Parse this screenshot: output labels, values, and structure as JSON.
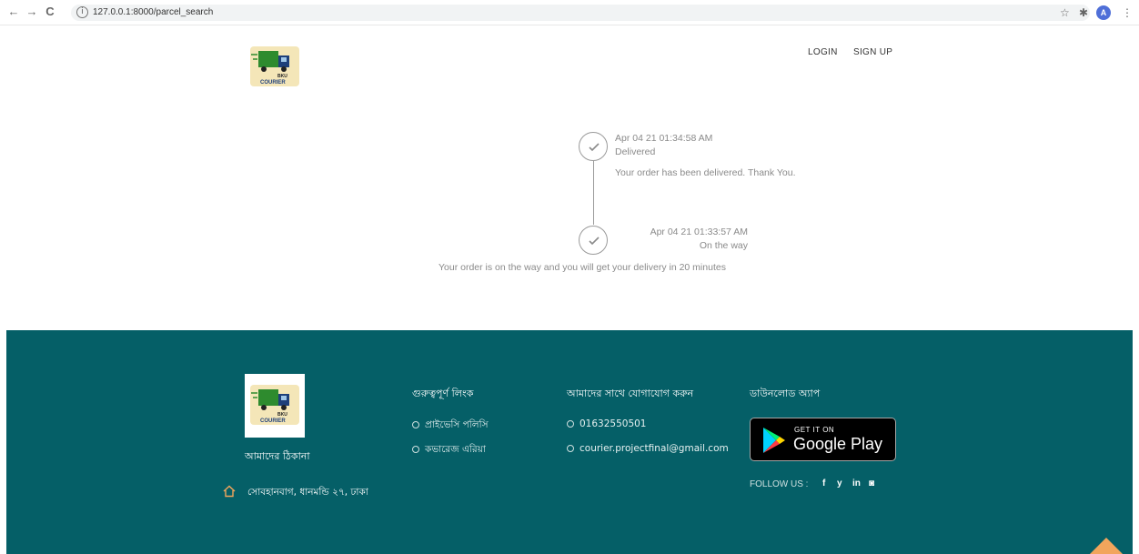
{
  "browser": {
    "back": "←",
    "forward": "→",
    "reload": "C",
    "info": "i",
    "url": "127.0.0.1:8000/parcel_search",
    "star": "☆",
    "extensions": "✱",
    "profile_initial": "A",
    "menu": "⋮"
  },
  "header": {
    "logo_top": "BKU",
    "logo_bottom": "COURIER",
    "nav": [
      "LOGIN",
      "SIGN UP"
    ]
  },
  "timeline": [
    {
      "datetime": "Apr 04 21 01:34:58 AM",
      "status": "Delivered",
      "message": "Your order has been delivered. Thank You."
    },
    {
      "datetime": "Apr 04 21 01:33:57 AM",
      "status": "On the way",
      "message": "Your order is on the way and you will get your delivery in 20 minutes"
    }
  ],
  "footer": {
    "logo_top": "BKU",
    "logo_bottom": "COURIER",
    "address_heading": "আমাদের ঠিকানা",
    "address": "সোবহানবাগ, ধানমন্ডি ২৭, ঢাকা",
    "links_heading": "গুরুত্বপূর্ণ লিংক",
    "links": [
      "প্রাইভেসি পলিসি",
      "কভারেজ এরিয়া"
    ],
    "contact_heading": "আমাদের সাথে যোগাযোগ করুন",
    "contact": [
      "01632550501",
      "courier.projectfinal@gmail.com"
    ],
    "download_heading": "ডাউনলোড অ্যাপ",
    "store_small": "GET IT ON",
    "store_big": "Google Play",
    "follow_label": "FOLLOW US :",
    "social": [
      "f",
      "y",
      "in",
      "◙"
    ]
  },
  "colors": {
    "footer_bg": "#055f67",
    "accent": "#f2a55c",
    "truck_green": "#2e8b2e"
  }
}
